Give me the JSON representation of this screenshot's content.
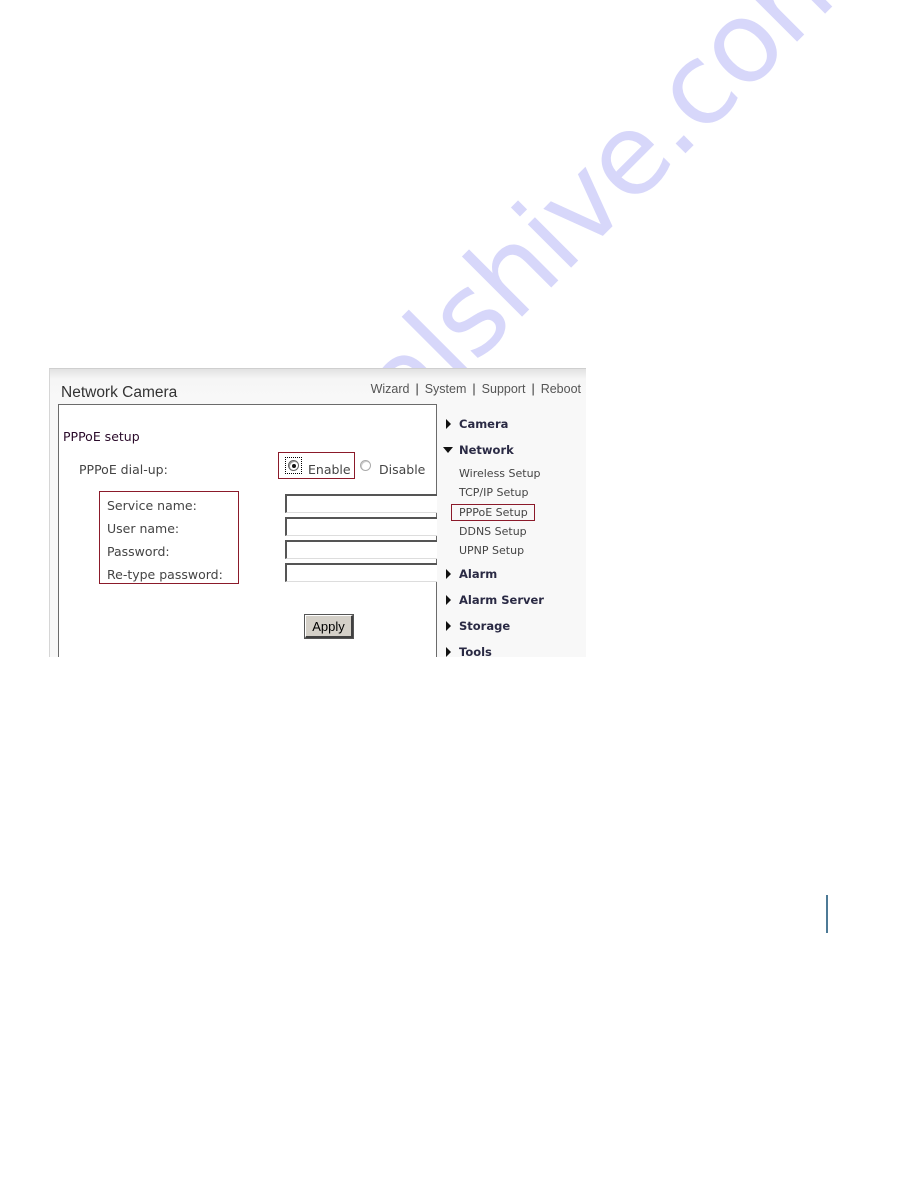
{
  "header": {
    "app_title": "Network Camera",
    "nav_links": [
      "Wizard",
      "System",
      "Support",
      "Reboot"
    ],
    "separator": "|"
  },
  "form": {
    "section_title": "PPPoE setup",
    "dialup_label": "PPPoE dial-up:",
    "dialup_options": [
      {
        "label": "Enable",
        "selected": true
      },
      {
        "label": "Disable",
        "selected": false
      }
    ],
    "fields": [
      {
        "label": "Service name:",
        "value": ""
      },
      {
        "label": "User name:",
        "value": ""
      },
      {
        "label": "Password:",
        "value": ""
      },
      {
        "label": "Re-type password:",
        "value": ""
      }
    ],
    "apply_label": "Apply"
  },
  "sidebar": {
    "sections": [
      {
        "label": "Camera",
        "expanded": false
      },
      {
        "label": "Network",
        "expanded": true,
        "items": [
          "Wireless Setup",
          "TCP/IP Setup",
          "PPPoE Setup",
          "DDNS Setup",
          "UPNP Setup"
        ],
        "active_item": "PPPoE Setup"
      },
      {
        "label": "Alarm",
        "expanded": false
      },
      {
        "label": "Alarm Server",
        "expanded": false
      },
      {
        "label": "Storage",
        "expanded": false
      },
      {
        "label": "Tools",
        "expanded": false
      }
    ]
  },
  "watermark": "manualshive.com",
  "colors": {
    "highlight_border": "#8b1a2a",
    "page_rule": "#4d7a96"
  }
}
